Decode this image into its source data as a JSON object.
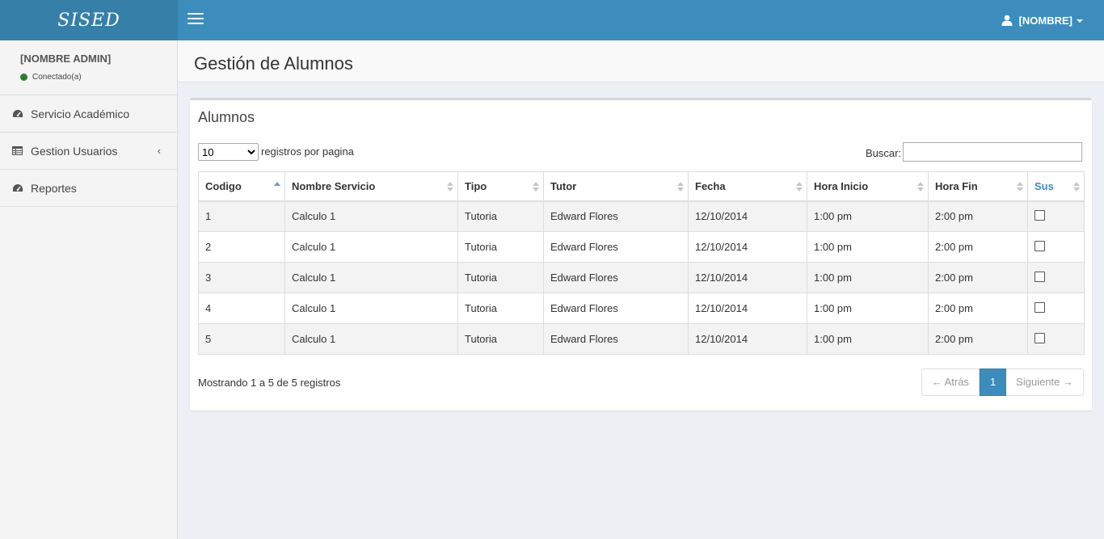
{
  "app": {
    "logo": "SISED"
  },
  "header": {
    "user_label": "[NOMBRE]"
  },
  "sidebar": {
    "user_name": "[NOMBRE ADMIN]",
    "status": "Conectado(a)",
    "items": [
      {
        "label": "Servicio Académico",
        "icon": "dashboard-icon"
      },
      {
        "label": "Gestion Usuarios",
        "icon": "table-icon"
      },
      {
        "label": "Reportes",
        "icon": "dashboard-icon"
      }
    ]
  },
  "page": {
    "title": "Gestión de Alumnos"
  },
  "box": {
    "title": "Alumnos",
    "page_length": "10",
    "page_length_label": "registros por pagina",
    "search_label": "Buscar:",
    "search_value": ""
  },
  "table": {
    "columns": [
      "Codigo",
      "Nombre Servicio",
      "Tipo",
      "Tutor",
      "Fecha",
      "Hora Inicio",
      "Hora Fin",
      "Sus"
    ],
    "rows": [
      [
        "1",
        "Calculo 1",
        "Tutoria",
        "Edward Flores",
        "12/10/2014",
        "1:00 pm",
        "2:00 pm"
      ],
      [
        "2",
        "Calculo 1",
        "Tutoria",
        "Edward Flores",
        "12/10/2014",
        "1:00 pm",
        "2:00 pm"
      ],
      [
        "3",
        "Calculo 1",
        "Tutoria",
        "Edward Flores",
        "12/10/2014",
        "1:00 pm",
        "2:00 pm"
      ],
      [
        "4",
        "Calculo 1",
        "Tutoria",
        "Edward Flores",
        "12/10/2014",
        "1:00 pm",
        "2:00 pm"
      ],
      [
        "5",
        "Calculo 1",
        "Tutoria",
        "Edward Flores",
        "12/10/2014",
        "1:00 pm",
        "2:00 pm"
      ]
    ]
  },
  "footer": {
    "info": "Mostrando 1 a 5 de 5 registros",
    "prev": "← Atrás",
    "page": "1",
    "next": "Siguiente →"
  },
  "colors": {
    "accent": "#3c8dbc",
    "logo_bg": "#367fa9",
    "status": "#2e7d32"
  }
}
